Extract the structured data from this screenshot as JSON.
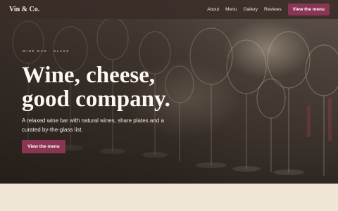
{
  "brand": "Vin & Co.",
  "nav": {
    "links": [
      "About",
      "Menu",
      "Gallery",
      "Reviews"
    ],
    "cta_label": "View the menu"
  },
  "hero": {
    "eyebrow": "Wine bar · glass",
    "headline_line1": "Wine, cheese,",
    "headline_line2": "good company.",
    "subtext": "A relaxed wine bar with natural wines, share plates and a curated by-the-glass list.",
    "cta_label": "View the menu"
  },
  "colors": {
    "accent": "#8a3553",
    "navbar": "#3a2c28",
    "page_bg": "#f0e6d6"
  }
}
